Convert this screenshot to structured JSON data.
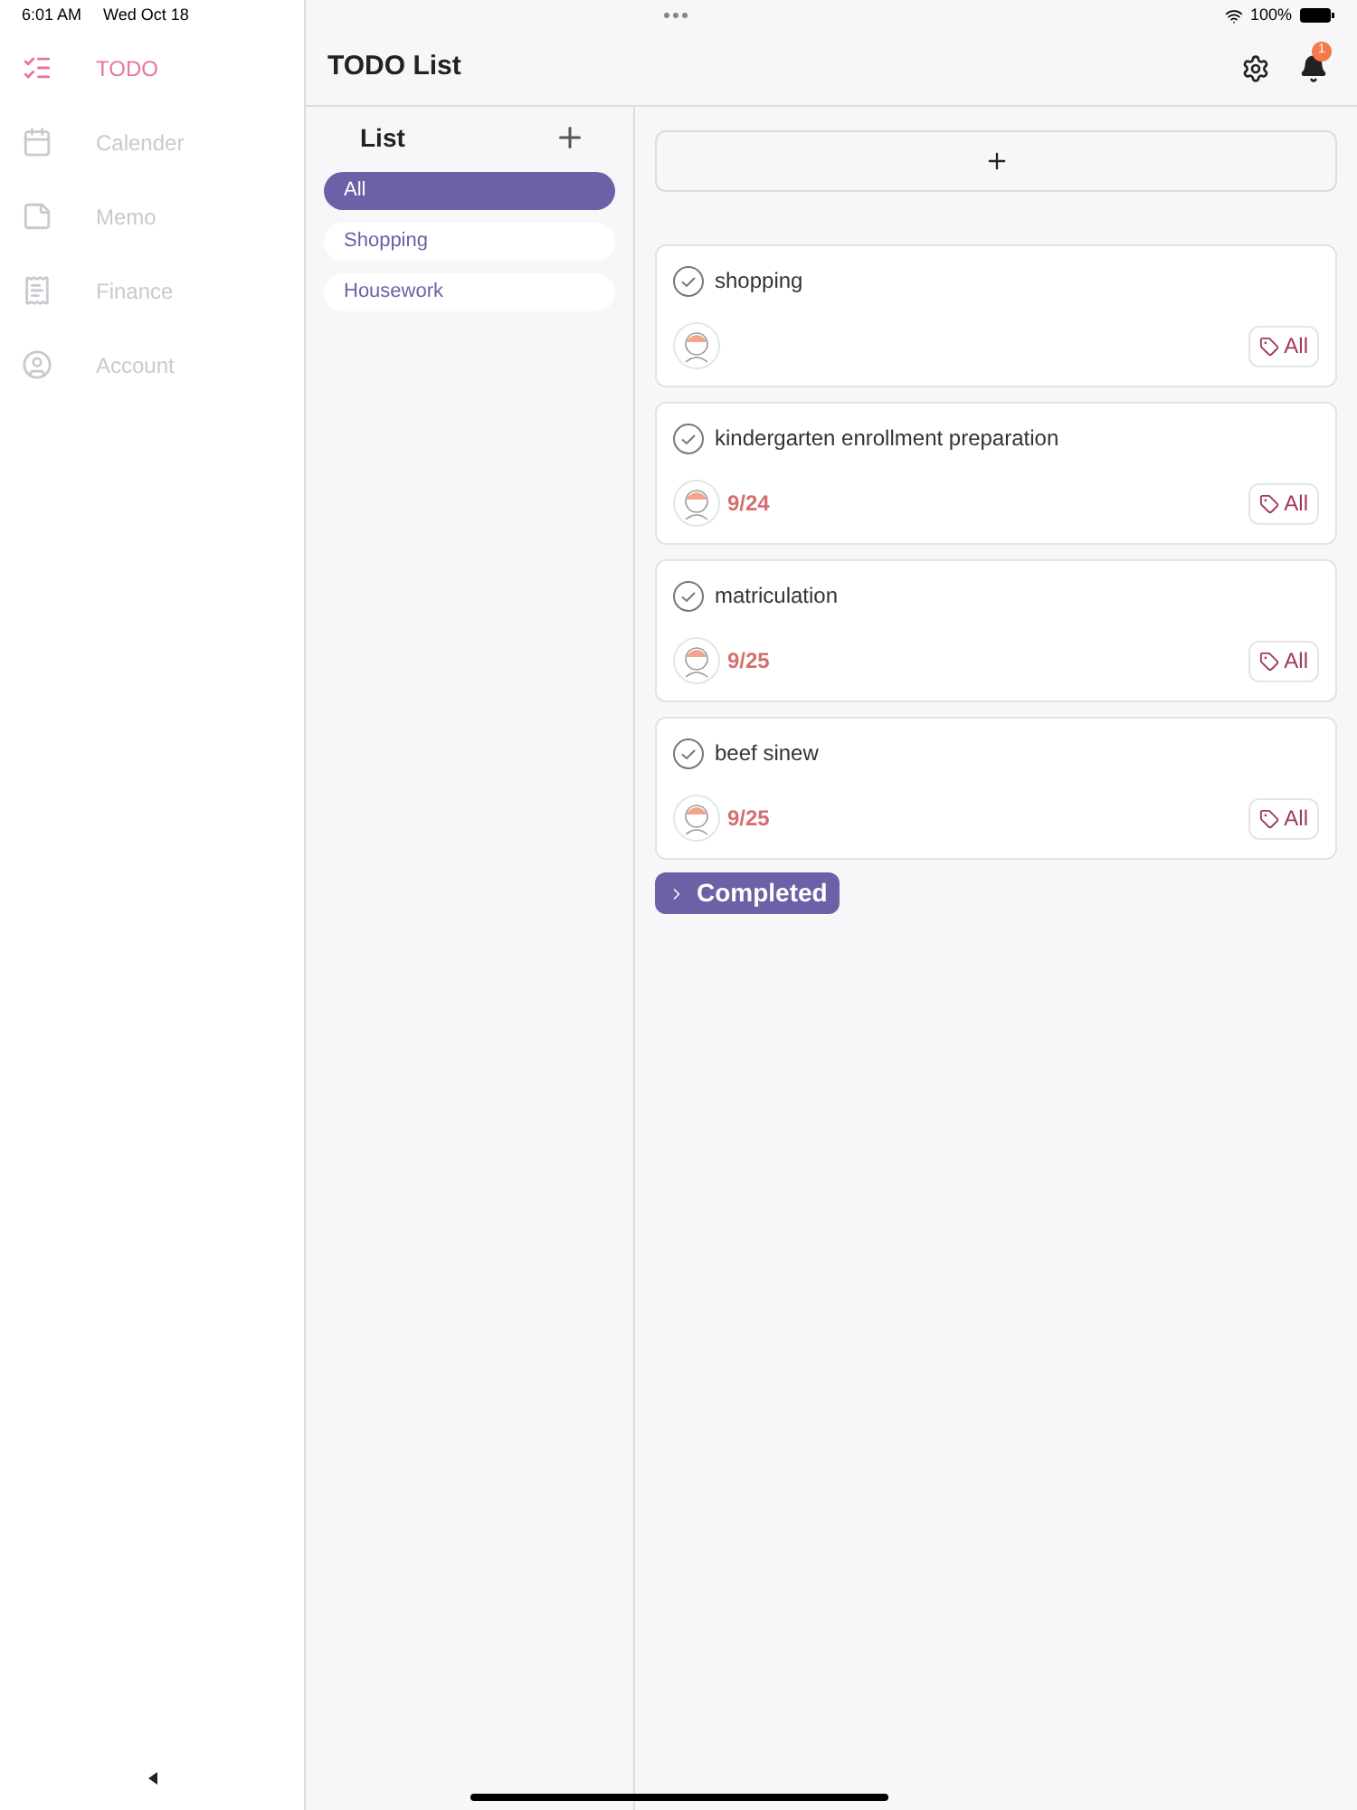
{
  "status_bar": {
    "time": "6:01 AM",
    "date": "Wed Oct 18",
    "battery": "100%"
  },
  "sidebar": {
    "items": [
      {
        "kind": "todo",
        "label": "TODO",
        "selected": true
      },
      {
        "kind": "calendar",
        "label": "Calender",
        "selected": false
      },
      {
        "kind": "memo",
        "label": "Memo",
        "selected": false
      },
      {
        "kind": "finance",
        "label": "Finance",
        "selected": false
      },
      {
        "kind": "account",
        "label": "Account",
        "selected": false
      }
    ]
  },
  "header": {
    "title": "TODO List",
    "notification_count": "1"
  },
  "lists": {
    "title": "List",
    "items": [
      {
        "label": "All",
        "selected": true
      },
      {
        "label": "Shopping",
        "selected": false
      },
      {
        "label": "Housework",
        "selected": false
      }
    ]
  },
  "tasks": [
    {
      "title": "shopping",
      "tag": "All"
    },
    {
      "title": "kindergarten enrollment preparation",
      "date": "9/24",
      "tag": "All"
    },
    {
      "title": "matriculation",
      "date": "9/25",
      "tag": "All"
    },
    {
      "title": "beef sinew",
      "date": "9/25",
      "tag": "All"
    }
  ],
  "completed": {
    "label": "Completed",
    "expanded": false
  }
}
